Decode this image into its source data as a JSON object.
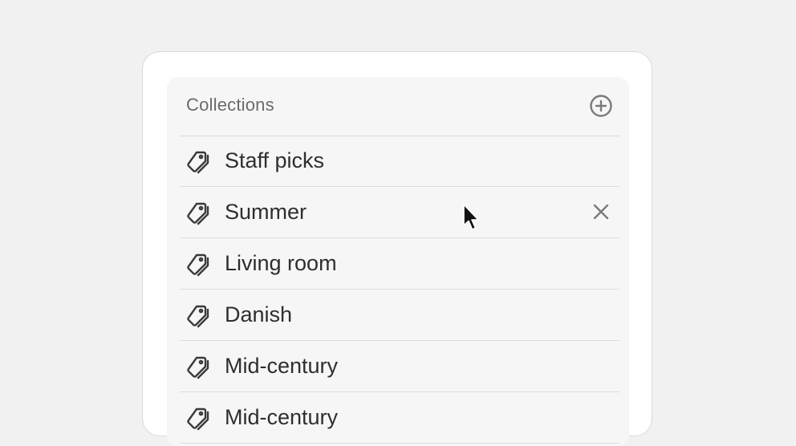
{
  "panel": {
    "title": "Collections",
    "add_icon": "plus-circle-icon"
  },
  "collections": [
    {
      "label": "Staff picks",
      "icon": "tag-icon",
      "hovered": false
    },
    {
      "label": "Summer",
      "icon": "tag-icon",
      "hovered": true,
      "remove_icon": "close-icon"
    },
    {
      "label": "Living room",
      "icon": "tag-icon",
      "hovered": false
    },
    {
      "label": "Danish",
      "icon": "tag-icon",
      "hovered": false
    },
    {
      "label": "Mid-century",
      "icon": "tag-icon",
      "hovered": false
    },
    {
      "label": "Mid-century",
      "icon": "tag-icon",
      "hovered": false
    }
  ],
  "colors": {
    "background": "#f1f1f1",
    "card": "#ffffff",
    "panel": "#f6f6f6",
    "divider": "#dcdcdc",
    "text": "#2e2e2e",
    "muted": "#6b6b6b"
  }
}
